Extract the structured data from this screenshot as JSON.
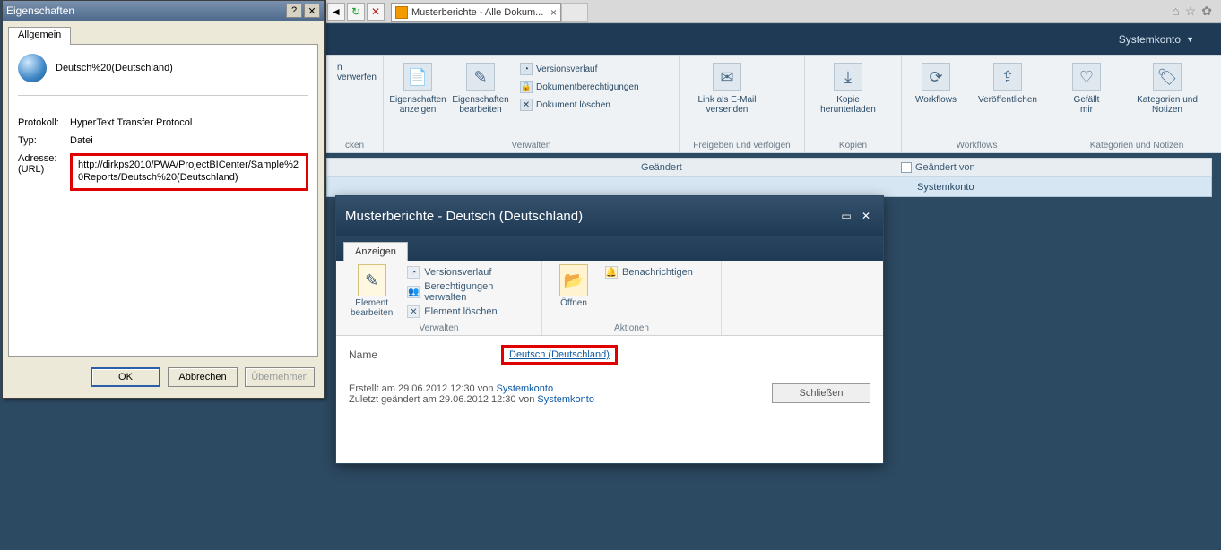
{
  "browser": {
    "tab_label": "Musterberichte - Alle Dokum...",
    "nav": {
      "back": "◄",
      "refresh": "↻",
      "stop": "✕"
    },
    "titlebar_icons": {
      "home": "⌂",
      "star": "☆",
      "gear": "✿"
    }
  },
  "user_row": {
    "account": "Systemkonto"
  },
  "ribbon": {
    "groups": {
      "drucken": {
        "label_suffix": "cken",
        "btn1_suffix": "n verwerfen"
      },
      "verwalten": {
        "label": "Verwalten",
        "eig_anzeigen": "Eigenschaften\nanzeigen",
        "eig_bearbeiten": "Eigenschaften\nbearbeiten",
        "versionsverlauf": "Versionsverlauf",
        "dokumentberechtigungen": "Dokumentberechtigungen",
        "dokument_loeschen": "Dokument löschen"
      },
      "freigeben": {
        "label": "Freigeben und verfolgen",
        "link_email": "Link als E-Mail\nversenden"
      },
      "kopien": {
        "label": "Kopien",
        "herunterladen": "Kopie\nherunterladen"
      },
      "workflows": {
        "label": "Workflows",
        "workflows_btn": "Workflows",
        "veroeffentlichen": "Veröffentlichen"
      },
      "kategorien": {
        "label": "Kategorien und Notizen",
        "gefaellt": "Gefällt\nmir",
        "kategorien_btn": "Kategorien und\nNotizen"
      }
    }
  },
  "list": {
    "col_geaendert": "Geändert",
    "col_geaendert_von": "Geändert von",
    "row_geaendert_von": "Systemkonto"
  },
  "props": {
    "title": "Eigenschaften",
    "tab": "Allgemein",
    "name_value": "Deutsch%20(Deutschland)",
    "protokoll_k": "Protokoll:",
    "protokoll_v": "HyperText Transfer Protocol",
    "typ_k": "Typ:",
    "typ_v": "Datei",
    "adresse_k": "Adresse:\n(URL)",
    "adresse_v": "http://dirkps2010/PWA/ProjectBICenter/Sample%20Reports/Deutsch%20(Deutschland)",
    "ok": "OK",
    "abbrechen": "Abbrechen",
    "uebernehmen": "Übernehmen"
  },
  "modal": {
    "title": "Musterberichte - Deutsch (Deutschland)",
    "tab": "Anzeigen",
    "verwalten_label": "Verwalten",
    "aktionen_label": "Aktionen",
    "element_bearbeiten": "Element\nbearbeiten",
    "versionsverlauf": "Versionsverlauf",
    "berechtigungen": "Berechtigungen verwalten",
    "element_loeschen": "Element löschen",
    "oeffnen": "Öffnen",
    "benachrichtigen": "Benachrichtigen",
    "detail_name_k": "Name",
    "detail_name_v": "Deutsch (Deutschland)",
    "erstellt": "Erstellt am 29.06.2012 12:30 von ",
    "erstellt_user": "Systemkonto",
    "zuletzt": "Zuletzt geändert am 29.06.2012 12:30 von ",
    "zuletzt_user": "Systemkonto",
    "close": "Schließen"
  }
}
